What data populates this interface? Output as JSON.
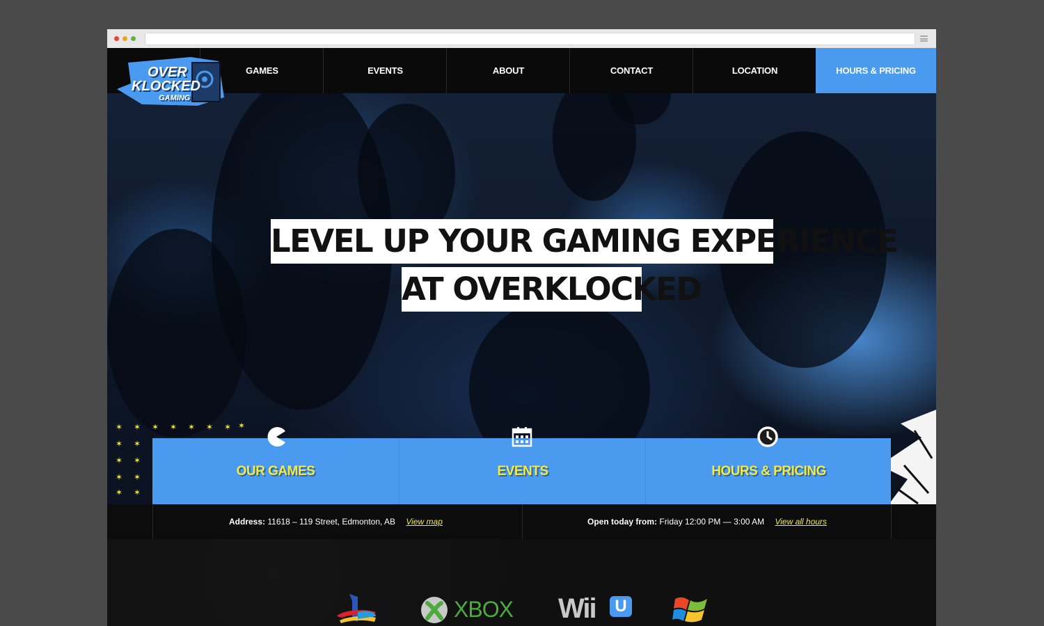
{
  "nav": {
    "brand": {
      "line1": "OVER",
      "line2": "KLOCKED",
      "line3": "GAMING"
    },
    "items": [
      {
        "label": "GAMES"
      },
      {
        "label": "EVENTS"
      },
      {
        "label": "ABOUT"
      },
      {
        "label": "CONTACT"
      },
      {
        "label": "LOCATION"
      },
      {
        "label": "HOURS & PRICING",
        "active": true
      }
    ]
  },
  "hero": {
    "headline_line1": "LEVEL UP YOUR GAMING EXPERIENCE",
    "headline_line2": "AT OVERKLOCKED"
  },
  "features": [
    {
      "label": "OUR GAMES",
      "icon": "pacman-icon"
    },
    {
      "label": "EVENTS",
      "icon": "calendar-icon"
    },
    {
      "label": "HOURS & PRICING",
      "icon": "clock-icon"
    }
  ],
  "info": {
    "address_label": "Address:",
    "address_value": "11618 – 119 Street, Edmonton, AB",
    "address_link": "View map",
    "hours_label": "Open today from:",
    "hours_value": "Friday 12:00 PM — 3:00 AM",
    "hours_link": "View all hours"
  },
  "platforms": {
    "items": [
      {
        "icon": "playstation-icon"
      },
      {
        "icon": "xbox-icon",
        "text": "XBOX"
      },
      {
        "icon": "wiiu-icon",
        "text": "Wii",
        "badge": "U"
      },
      {
        "icon": "windows-icon"
      }
    ]
  },
  "colors": {
    "accent_blue": "#4a9bef",
    "accent_yellow": "#f2e94a",
    "nav_bg": "#0a0a0b",
    "xbox_green": "#4cab3c"
  }
}
